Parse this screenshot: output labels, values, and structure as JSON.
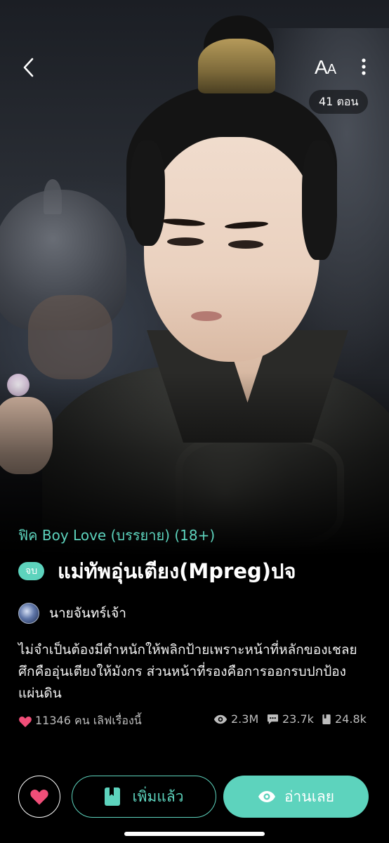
{
  "header": {
    "font_label_big": "A",
    "font_label_small": "A",
    "episode_count": "41 ตอน"
  },
  "novel": {
    "genre": "ฟิค Boy Love (บรรยาย) (18+)",
    "status_badge": "จบ",
    "title": "แม่ทัพอุ่นเตียง(Mpreg)ปจ",
    "author": "นายจันทร์เจ้า",
    "synopsis": "ไม่จำเป็นต้องมีตำหนักให้พลิกป้ายเพราะหน้าที่หลักของเชลยศึกคืออุ่นเตียงให้มังกร ส่วนหน้าที่รองคือการออกรบปกป้องแผ่นดิน"
  },
  "stats": {
    "likes_text": "11346 คน เลิฟเรื่องนี้",
    "views": "2.3M",
    "comments": "23.7k",
    "bookmarks": "24.8k"
  },
  "actions": {
    "library_label": "เพิ่มแล้ว",
    "read_label": "อ่านเลย"
  },
  "colors": {
    "accent": "#5dd3bd",
    "heart": "#f04e78",
    "background": "#000000"
  }
}
